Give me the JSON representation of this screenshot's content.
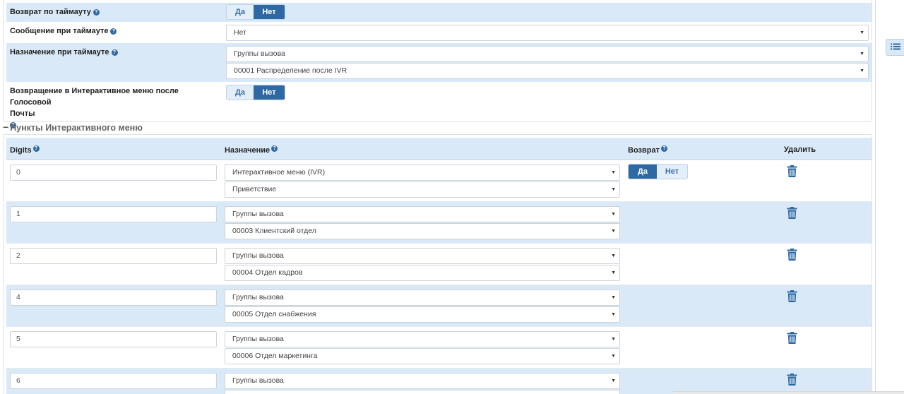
{
  "settings": {
    "timeout_return": {
      "label": "Возврат по таймауту",
      "yes": "Да",
      "no": "Нет"
    },
    "timeout_message": {
      "label": "Сообщение при таймауте",
      "value": "Нет"
    },
    "timeout_destination": {
      "label": "Назначение при таймауте",
      "type_value": "Группы вызова",
      "target_value": "00001 Распределение после IVR"
    },
    "return_after_voicemail": {
      "label_line1": "Возвращение в Интерактивное меню после Голосовой",
      "label_line2": "Почты",
      "yes": "Да",
      "no": "Нет"
    }
  },
  "section_title": "Пункты Интерактивного меню",
  "table": {
    "headers": {
      "digits": "Digits",
      "destination": "Назначение",
      "return": "Возврат",
      "delete": "Удалить"
    },
    "rows": [
      {
        "digit": "0",
        "type": "Интерактивное меню (IVR)",
        "target": "Приветствие",
        "return_yes": "Да",
        "return_no": "Нет"
      },
      {
        "digit": "1",
        "type": "Группы вызова",
        "target": "00003 Клиентский отдел"
      },
      {
        "digit": "2",
        "type": "Группы вызова",
        "target": "00004 Отдел кадров"
      },
      {
        "digit": "4",
        "type": "Группы вызова",
        "target": "00005 Отдел снабжения"
      },
      {
        "digit": "5",
        "type": "Группы вызова",
        "target": "00006 Отдел маркетинга"
      },
      {
        "digit": "6",
        "type": "Группы вызова",
        "target": ""
      }
    ]
  },
  "colors": {
    "accent": "#2f69a3",
    "row_alt": "#d9e9f7"
  },
  "icons": {
    "help": "question-circle-icon",
    "delete": "trash-icon",
    "side": "list-icon",
    "caret": "caret-down-icon"
  }
}
